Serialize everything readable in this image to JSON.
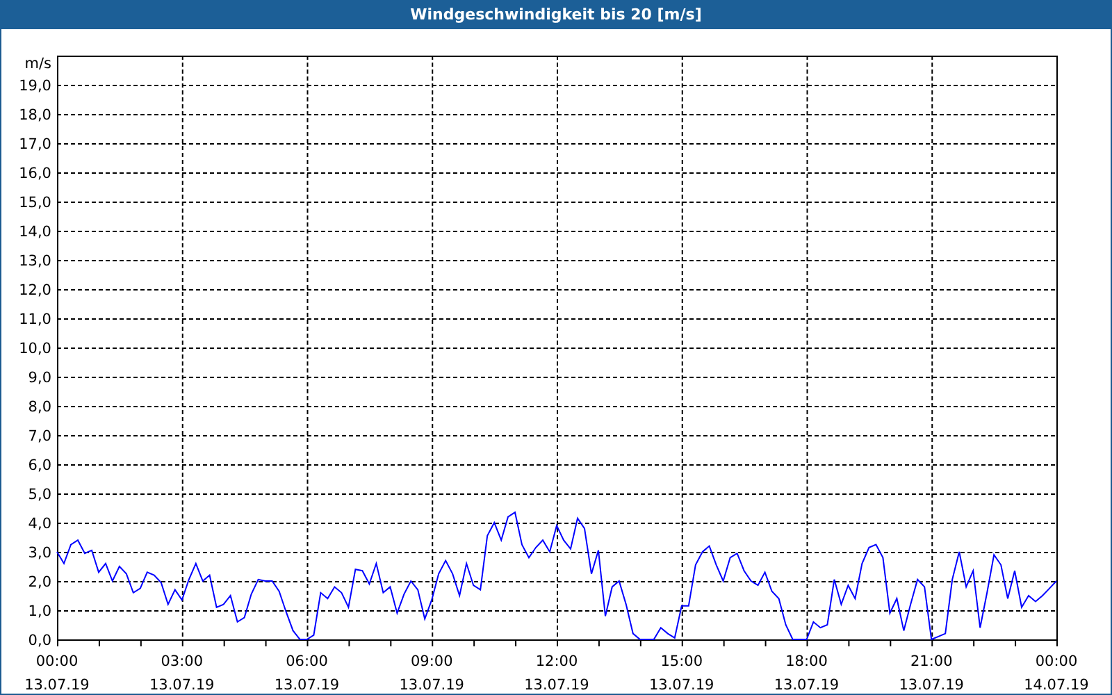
{
  "window": {
    "title": "Windgeschwindigkeit bis 20 [m/s]"
  },
  "chart": {
    "chart_data": {
      "type": "line",
      "grid": true,
      "ylabel": "m/s",
      "ylim": [
        0,
        20
      ],
      "categories": [
        "00:00\n13.07.19",
        null,
        null,
        null,
        null,
        null,
        null,
        null,
        null,
        null,
        null,
        null,
        null,
        null,
        null,
        null,
        null,
        null,
        "03:00\n13.07.19",
        null,
        null,
        null,
        null,
        null,
        null,
        null,
        null,
        null,
        null,
        null,
        null,
        null,
        null,
        null,
        null,
        null,
        "06:00\n13.07.19",
        null,
        null,
        null,
        null,
        null,
        null,
        null,
        null,
        null,
        null,
        null,
        null,
        null,
        null,
        null,
        null,
        null,
        "09:00\n13.07.19",
        null,
        null,
        null,
        null,
        null,
        null,
        null,
        null,
        null,
        null,
        null,
        null,
        null,
        null,
        null,
        null,
        null,
        "12:00\n13.07.19",
        null,
        null,
        null,
        null,
        null,
        null,
        null,
        null,
        null,
        null,
        null,
        null,
        null,
        null,
        null,
        null,
        null,
        "15:00\n13.07.19",
        null,
        null,
        null,
        null,
        null,
        null,
        null,
        null,
        null,
        null,
        null,
        null,
        null,
        null,
        null,
        null,
        null,
        "18:00\n13.07.19",
        null,
        null,
        null,
        null,
        null,
        null,
        null,
        null,
        null,
        null,
        null,
        null,
        null,
        null,
        null,
        null,
        null,
        "21:00\n13.07.19",
        null,
        null,
        null,
        null,
        null,
        null,
        null,
        null,
        null,
        null,
        null,
        null,
        null,
        null,
        null,
        null,
        null,
        "00:00\n14.07.19"
      ],
      "series": [
        {
          "color": "#0000ff",
          "values": [
            3.0,
            2.6,
            3.25,
            3.4,
            2.95,
            3.05,
            2.3,
            2.6,
            2.0,
            2.5,
            2.25,
            1.6,
            1.75,
            2.3,
            2.2,
            1.95,
            1.2,
            1.7,
            1.35,
            2.05,
            2.6,
            2.0,
            2.2,
            1.1,
            1.2,
            1.5,
            0.6,
            0.75,
            1.55,
            2.05,
            2.0,
            2.0,
            1.65,
            0.95,
            0.3,
            0,
            0,
            0.15,
            1.6,
            1.4,
            1.8,
            1.6,
            1.1,
            2.4,
            2.35,
            1.9,
            2.6,
            1.6,
            1.8,
            0.9,
            1.55,
            2.0,
            1.7,
            0.7,
            1.35,
            2.25,
            2.7,
            2.25,
            1.5,
            2.6,
            1.85,
            1.7,
            3.55,
            4.0,
            3.4,
            4.2,
            4.35,
            3.25,
            2.8,
            3.15,
            3.4,
            3.0,
            3.9,
            3.4,
            3.1,
            4.15,
            3.8,
            2.25,
            3.05,
            0.8,
            1.8,
            2.0,
            1.2,
            0.2,
            0,
            0,
            0,
            0.4,
            0.2,
            0.05,
            1.15,
            1.15,
            2.55,
            3.0,
            3.2,
            2.55,
            2.0,
            2.8,
            2.95,
            2.35,
            2.0,
            1.85,
            2.3,
            1.65,
            1.4,
            0.5,
            0,
            0,
            0,
            0.6,
            0.4,
            0.5,
            2.05,
            1.2,
            1.85,
            1.4,
            2.6,
            3.15,
            3.25,
            2.8,
            0.9,
            1.4,
            0.3,
            1.2,
            2.05,
            1.8,
            0,
            0.1,
            0.2,
            2.05,
            3.0,
            1.8,
            2.35,
            0.4,
            1.6,
            2.9,
            2.55,
            1.4,
            2.35,
            1.1,
            1.5,
            1.3,
            1.5,
            1.75,
            2.0
          ]
        }
      ],
      "yticks": [
        {
          "value": 0,
          "label": "0,0"
        },
        {
          "value": 1,
          "label": "1,0"
        },
        {
          "value": 2,
          "label": "2,0"
        },
        {
          "value": 3,
          "label": "3,0"
        },
        {
          "value": 4,
          "label": "4,0"
        },
        {
          "value": 5,
          "label": "5,0"
        },
        {
          "value": 6,
          "label": "6,0"
        },
        {
          "value": 7,
          "label": "7,0"
        },
        {
          "value": 8,
          "label": "8,0"
        },
        {
          "value": 9,
          "label": "9,0"
        },
        {
          "value": 10,
          "label": "10,0"
        },
        {
          "value": 11,
          "label": "11,0"
        },
        {
          "value": 12,
          "label": "12,0"
        },
        {
          "value": 13,
          "label": "13,0"
        },
        {
          "value": 14,
          "label": "14,0"
        },
        {
          "value": 15,
          "label": "15,0"
        },
        {
          "value": 16,
          "label": "16,0"
        },
        {
          "value": 17,
          "label": "17,0"
        },
        {
          "value": 18,
          "label": "18,0"
        },
        {
          "value": 19,
          "label": "19,0"
        }
      ]
    }
  }
}
